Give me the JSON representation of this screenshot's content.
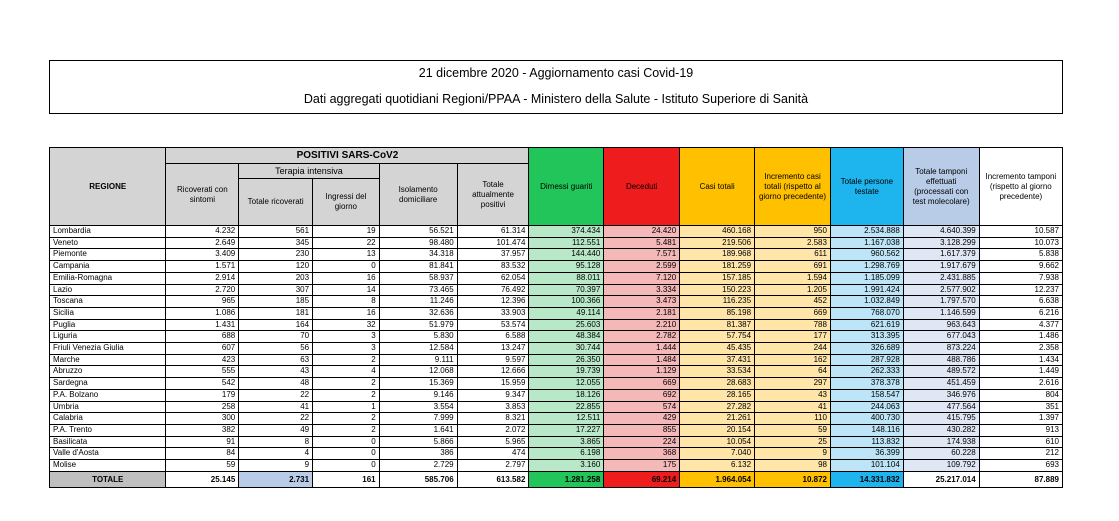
{
  "header": {
    "title": "21 dicembre 2020 - Aggiornamento casi Covid-19",
    "subtitle": "Dati aggregati quotidiani Regioni/PPAA - Ministero della Salute - Istituto Superiore di Sanità"
  },
  "table": {
    "headers": {
      "regione": "REGIONE",
      "positivi": "POSITIVI SARS-CoV2",
      "terapia_intensiva": "Terapia intensiva",
      "ricoverati_sintomi": "Ricoverati con sintomi",
      "totale_ricoverati": "Totale ricoverati",
      "ingressi_giorno": "Ingressi del giorno",
      "isolamento": "Isolamento domiciliare",
      "totale_positivi": "Totale attualmente positivi",
      "dimessi": "Dimessi guariti",
      "deceduti": "Deceduti",
      "casi_totali": "Casi totali",
      "incremento_casi": "Incremento casi totali (rispetto al giorno precedente)",
      "persone_testate": "Totale persone testate",
      "tamponi": "Totale tamponi effettuati (processati con test molecolare)",
      "incremento_tamponi": "Incremento tamponi (rispetto al giorno precedente)"
    },
    "rows": [
      [
        "Lombardia",
        "4.232",
        "561",
        "19",
        "56.521",
        "61.314",
        "374.434",
        "24.420",
        "460.168",
        "950",
        "2.534.888",
        "4.640.399",
        "10.587"
      ],
      [
        "Veneto",
        "2.649",
        "345",
        "22",
        "98.480",
        "101.474",
        "112.551",
        "5.481",
        "219.506",
        "2.583",
        "1.167.038",
        "3.128.299",
        "10.073"
      ],
      [
        "Piemonte",
        "3.409",
        "230",
        "13",
        "34.318",
        "37.957",
        "144.440",
        "7.571",
        "189.968",
        "611",
        "960.562",
        "1.617.379",
        "5.838"
      ],
      [
        "Campania",
        "1.571",
        "120",
        "0",
        "81.841",
        "83.532",
        "95.128",
        "2.599",
        "181.259",
        "691",
        "1.298.769",
        "1.917.679",
        "9.662"
      ],
      [
        "Emilia-Romagna",
        "2.914",
        "203",
        "16",
        "58.937",
        "62.054",
        "88.011",
        "7.120",
        "157.185",
        "1.594",
        "1.185.099",
        "2.431.885",
        "7.938"
      ],
      [
        "Lazio",
        "2.720",
        "307",
        "14",
        "73.465",
        "76.492",
        "70.397",
        "3.334",
        "150.223",
        "1.205",
        "1.991.424",
        "2.577.902",
        "12.237"
      ],
      [
        "Toscana",
        "965",
        "185",
        "8",
        "11.246",
        "12.396",
        "100.366",
        "3.473",
        "116.235",
        "452",
        "1.032.849",
        "1.797.570",
        "6.638"
      ],
      [
        "Sicilia",
        "1.086",
        "181",
        "16",
        "32.636",
        "33.903",
        "49.114",
        "2.181",
        "85.198",
        "669",
        "768.070",
        "1.146.599",
        "6.216"
      ],
      [
        "Puglia",
        "1.431",
        "164",
        "32",
        "51.979",
        "53.574",
        "25.603",
        "2.210",
        "81.387",
        "788",
        "621.619",
        "963.643",
        "4.377"
      ],
      [
        "Liguria",
        "688",
        "70",
        "3",
        "5.830",
        "6.588",
        "48.384",
        "2.782",
        "57.754",
        "177",
        "313.395",
        "677.043",
        "1.486"
      ],
      [
        "Friuli Venezia Giulia",
        "607",
        "56",
        "3",
        "12.584",
        "13.247",
        "30.744",
        "1.444",
        "45.435",
        "244",
        "326.689",
        "873.224",
        "2.358"
      ],
      [
        "Marche",
        "423",
        "63",
        "2",
        "9.111",
        "9.597",
        "26.350",
        "1.484",
        "37.431",
        "162",
        "287.928",
        "488.786",
        "1.434"
      ],
      [
        "Abruzzo",
        "555",
        "43",
        "4",
        "12.068",
        "12.666",
        "19.739",
        "1.129",
        "33.534",
        "64",
        "262.333",
        "489.572",
        "1.449"
      ],
      [
        "Sardegna",
        "542",
        "48",
        "2",
        "15.369",
        "15.959",
        "12.055",
        "669",
        "28.683",
        "297",
        "378.378",
        "451.459",
        "2.616"
      ],
      [
        "P.A. Bolzano",
        "179",
        "22",
        "2",
        "9.146",
        "9.347",
        "18.126",
        "692",
        "28.165",
        "43",
        "158.547",
        "346.976",
        "804"
      ],
      [
        "Umbria",
        "258",
        "41",
        "1",
        "3.554",
        "3.853",
        "22.855",
        "574",
        "27.282",
        "41",
        "244.063",
        "477.564",
        "351"
      ],
      [
        "Calabria",
        "300",
        "22",
        "2",
        "7.999",
        "8.321",
        "12.511",
        "429",
        "21.261",
        "110",
        "400.730",
        "415.795",
        "1.397"
      ],
      [
        "P.A. Trento",
        "382",
        "49",
        "2",
        "1.641",
        "2.072",
        "17.227",
        "855",
        "20.154",
        "59",
        "148.116",
        "430.282",
        "913"
      ],
      [
        "Basilicata",
        "91",
        "8",
        "0",
        "5.866",
        "5.965",
        "3.865",
        "224",
        "10.054",
        "25",
        "113.832",
        "174.938",
        "610"
      ],
      [
        "Valle d'Aosta",
        "84",
        "4",
        "0",
        "386",
        "474",
        "6.198",
        "368",
        "7.040",
        "9",
        "36.399",
        "60.228",
        "212"
      ],
      [
        "Molise",
        "59",
        "9",
        "0",
        "2.729",
        "2.797",
        "3.160",
        "175",
        "6.132",
        "98",
        "101.104",
        "109.792",
        "693"
      ]
    ],
    "totals": [
      "TOTALE",
      "25.145",
      "2.731",
      "161",
      "585.706",
      "613.582",
      "1.281.258",
      "69.214",
      "1.964.054",
      "10.872",
      "14.331.832",
      "25.217.014",
      "87.889"
    ]
  },
  "colors": {
    "grey_header": "#d4d4d4",
    "green": "#22c55a",
    "red": "#ee1c1c",
    "orange": "#ffc000",
    "cyan": "#1eb4ee",
    "light_blue": "#b8cce8"
  }
}
